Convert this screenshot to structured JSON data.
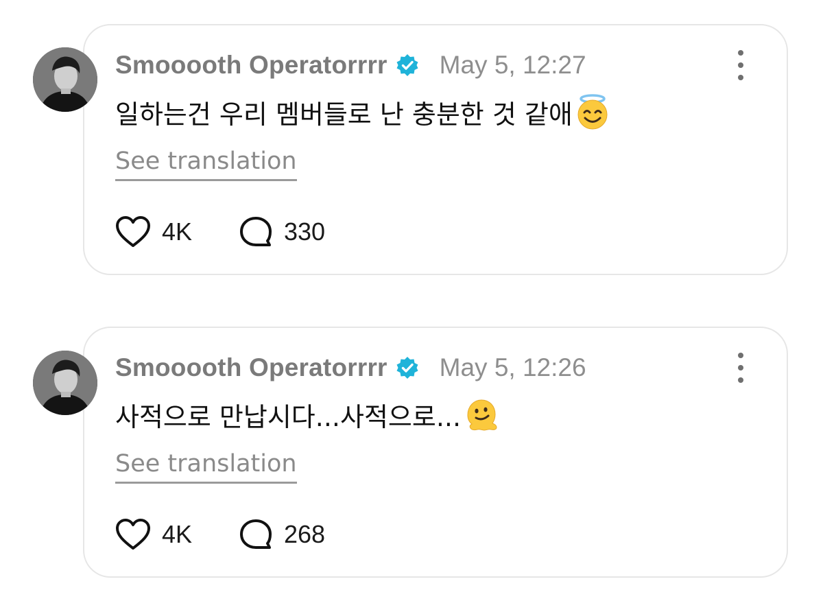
{
  "posts": [
    {
      "username": "Smooooth Operatorrrr",
      "verified": true,
      "timestamp": "May 5, 12:27",
      "text": "일하는건 우리 멤버들로 난 충분한 것 같애",
      "emoji_icon": "smiling-face-with-halo-icon",
      "translate_label": "See translation",
      "likes": "4K",
      "replies": "330"
    },
    {
      "username": "Smooooth Operatorrrr",
      "verified": true,
      "timestamp": "May 5, 12:26",
      "text": "사적으로 만납시다...사적으로...",
      "emoji_icon": "melting-face-icon",
      "translate_label": "See translation",
      "likes": "4K",
      "replies": "268"
    }
  ],
  "colors": {
    "verified_badge": "#1fb3d9",
    "username": "#7a7a7a",
    "timestamp": "#8e8e8e",
    "card_border": "#e6e6e6"
  },
  "icons": {
    "like": "heart-icon",
    "reply": "speech-bubble-icon",
    "more": "more-options-icon",
    "verified": "verified-badge-icon"
  }
}
